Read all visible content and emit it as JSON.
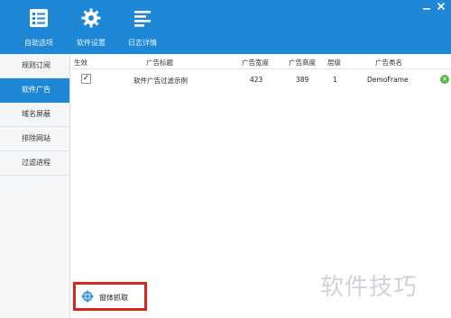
{
  "toolbar": {
    "items": [
      {
        "label": "自助选项",
        "icon": "checklist-icon"
      },
      {
        "label": "软件设置",
        "icon": "gear-icon"
      },
      {
        "label": "日志详情",
        "icon": "log-lines-icon"
      }
    ],
    "window_controls": [
      "minimize-icon",
      "close-icon"
    ]
  },
  "sidebar": {
    "items": [
      {
        "label": "规则订阅",
        "active": false
      },
      {
        "label": "软件广告",
        "active": true
      },
      {
        "label": "域名屏蔽",
        "active": false
      },
      {
        "label": "排除网站",
        "active": false
      },
      {
        "label": "过滤进程",
        "active": false
      }
    ]
  },
  "table": {
    "headers": [
      "生效",
      "广告标题",
      "广告宽度",
      "广告高度",
      "层级",
      "广告类名"
    ],
    "rows": [
      {
        "enabled": true,
        "check": "✓",
        "title": "软件广告过滤示例",
        "width": "423",
        "height": "389",
        "level": "1",
        "class_name": "DemoFrame",
        "status": "✕"
      }
    ]
  },
  "capture": {
    "label": "窗体抓取",
    "icon": "capture-icon"
  },
  "watermark": "软件技巧",
  "colors": {
    "accent": "#1e87d6",
    "highlight_border": "#d8261f",
    "status_ok": "#56b84a"
  }
}
